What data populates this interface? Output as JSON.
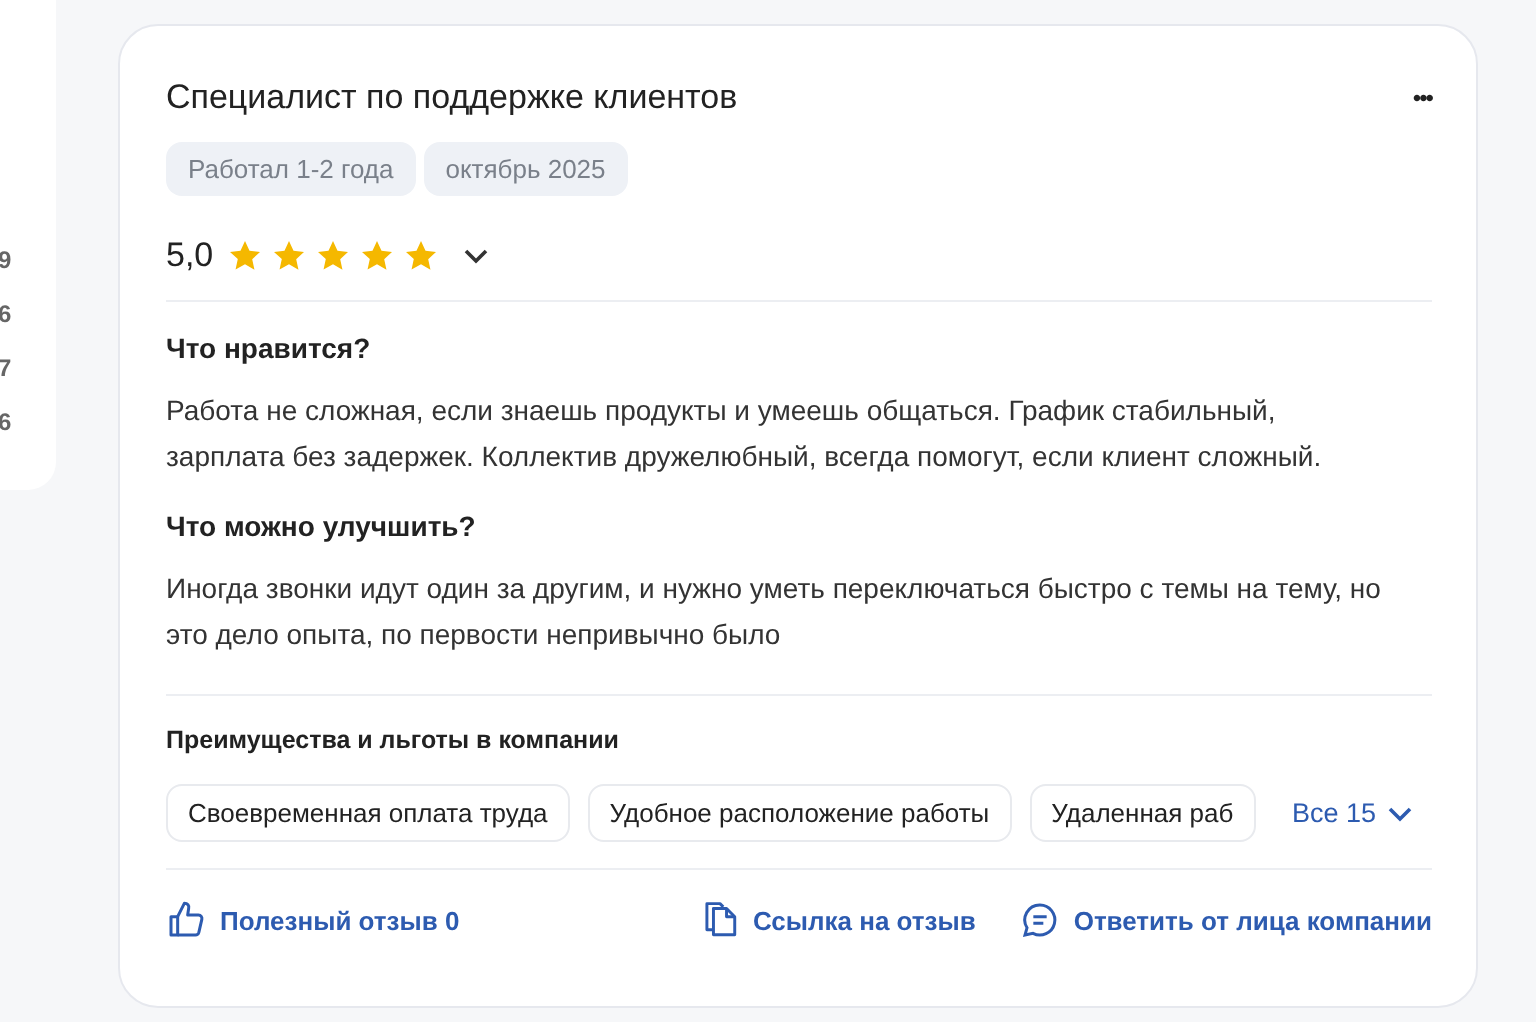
{
  "side_panel": {
    "numbers": [
      "9",
      "6",
      "7",
      "6"
    ]
  },
  "review": {
    "title": "Специалист по поддержке клиентов",
    "menu": "•••",
    "tags": [
      "Работал 1-2 года",
      "октябрь 2025"
    ],
    "rating": "5,0",
    "stars": 5,
    "sections": [
      {
        "heading": "Что нравится?",
        "text": "Работа не сложная, если знаешь продукты и умеешь общаться. График стабильный, зарплата без задержек. Коллектив дружелюбный, всегда помогут, если клиент сложный."
      },
      {
        "heading": "Что можно улучшить?",
        "text": "Иногда звонки идут один за другим, и нужно уметь переключаться быстро с темы на тему, но это дело опыта, по первости непривычно было"
      }
    ],
    "benefits": {
      "heading": "Преимущества и льготы в компании",
      "items": [
        "Своевременная оплата труда",
        "Удобное расположение работы",
        "Удаленная раб"
      ],
      "more": "Все 15"
    },
    "actions": [
      {
        "kind": "like",
        "label": "Полезный отзыв 0"
      },
      {
        "kind": "link",
        "label": "Ссылка на отзыв"
      },
      {
        "kind": "reply",
        "label": "Ответить от лица компании"
      }
    ]
  }
}
